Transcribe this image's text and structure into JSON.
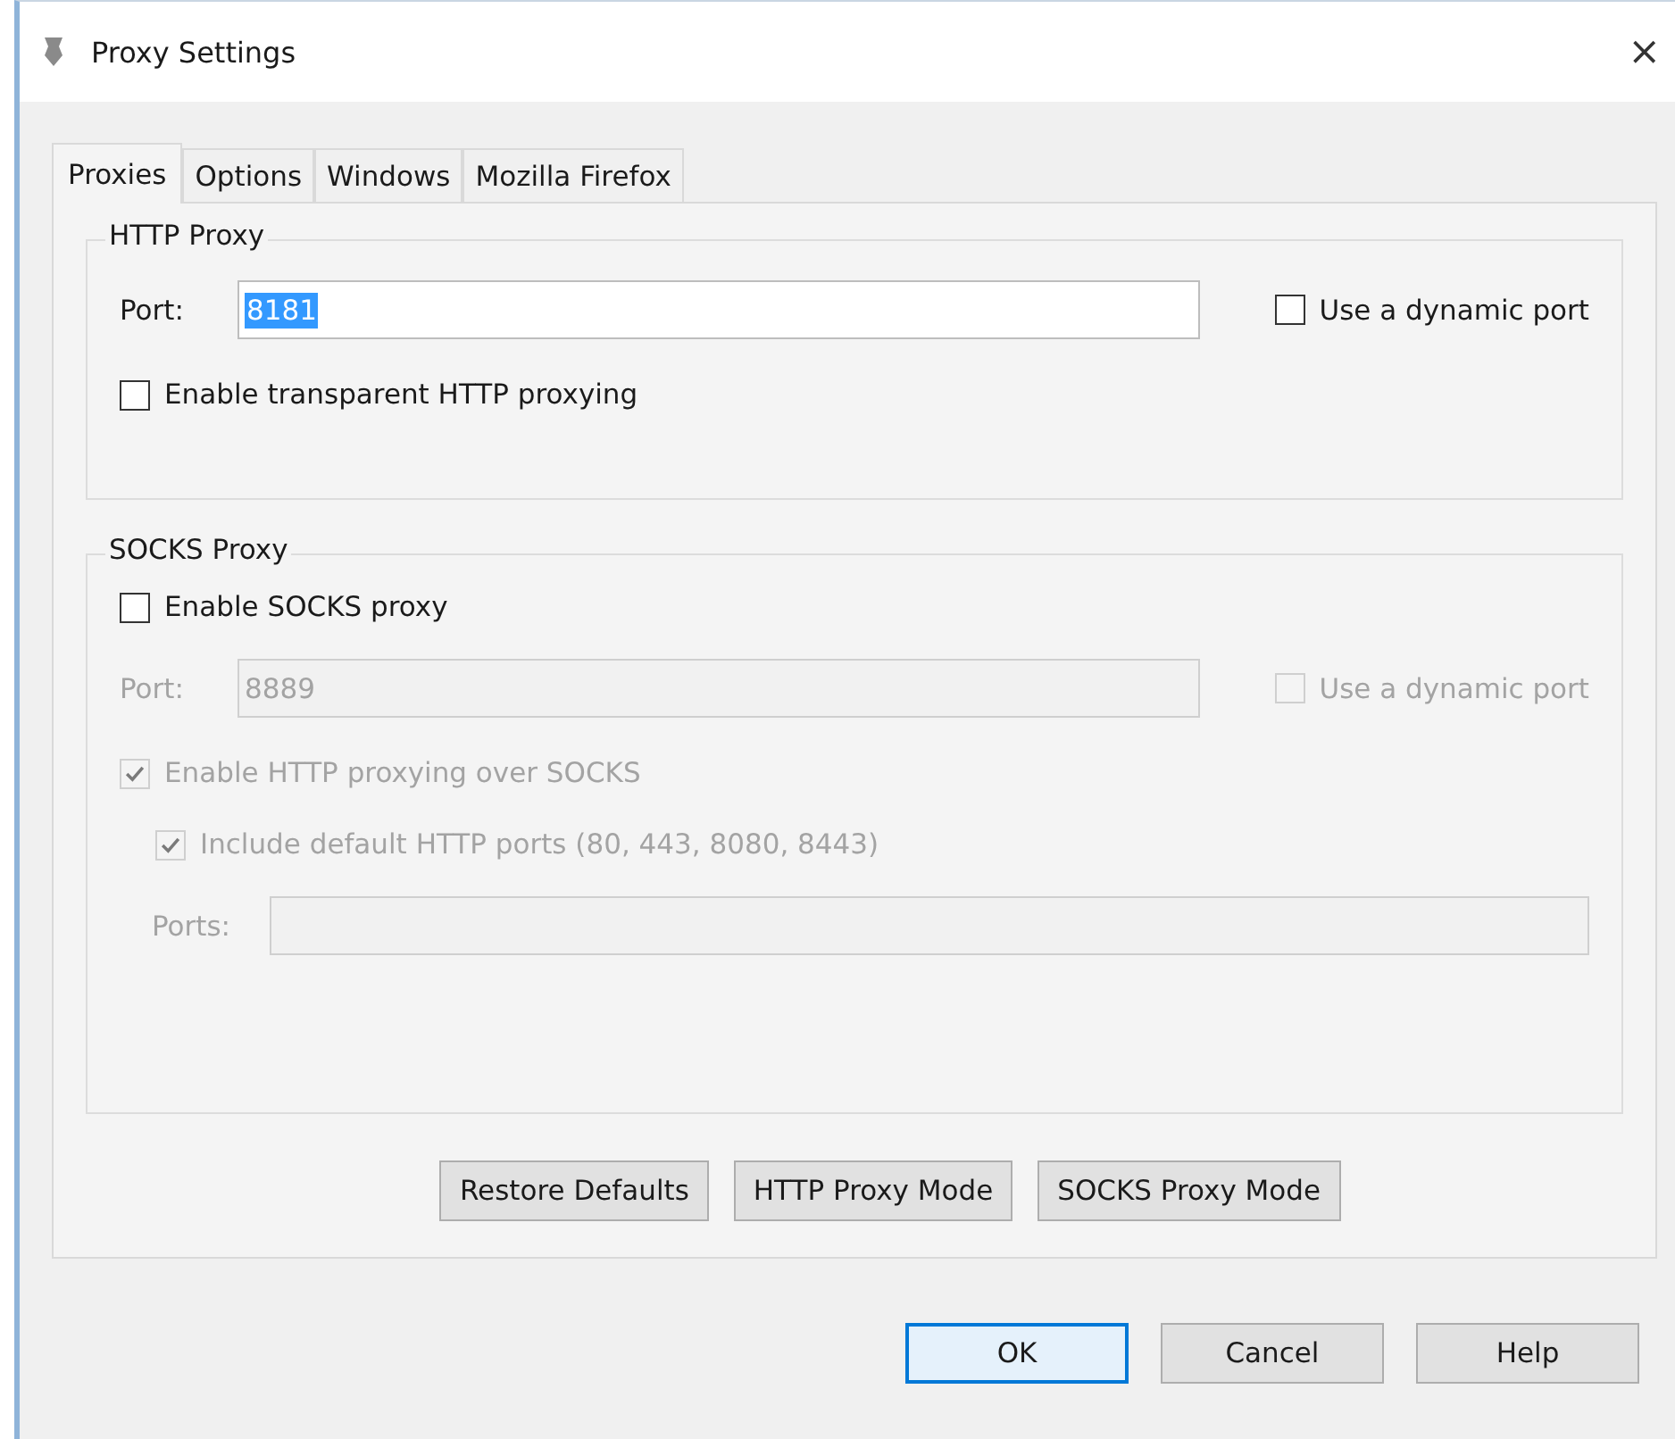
{
  "window": {
    "title": "Proxy Settings",
    "close": "×"
  },
  "tabs": [
    {
      "label": "Proxies",
      "selected": true
    },
    {
      "label": "Options",
      "selected": false
    },
    {
      "label": "Windows",
      "selected": false
    },
    {
      "label": "Mozilla Firefox",
      "selected": false
    }
  ],
  "http_proxy": {
    "title": "HTTP Proxy",
    "port_label": "Port:",
    "port_value": "8181",
    "port_value_selected": true,
    "port_disabled": false,
    "dynamic_port": {
      "label": "Use a dynamic port",
      "checked": false,
      "disabled": false
    },
    "transparent": {
      "label": "Enable transparent HTTP proxying",
      "checked": false,
      "disabled": false
    }
  },
  "socks_proxy": {
    "title": "SOCKS Proxy",
    "enable": {
      "label": "Enable SOCKS proxy",
      "checked": false,
      "disabled": false
    },
    "port_label": "Port:",
    "port_value": "8889",
    "port_disabled": true,
    "dynamic_port": {
      "label": "Use a dynamic port",
      "checked": false,
      "disabled": true
    },
    "http_over_socks": {
      "label": "Enable HTTP proxying over SOCKS",
      "checked": true,
      "disabled": true
    },
    "include_default_ports": {
      "label": "Include default HTTP ports (80, 443, 8080, 8443)",
      "checked": true,
      "disabled": true
    },
    "ports_label": "Ports:",
    "ports_disabled": true
  },
  "panel_buttons": [
    {
      "label": "Restore Defaults"
    },
    {
      "label": "HTTP Proxy Mode"
    },
    {
      "label": "SOCKS Proxy Mode"
    }
  ],
  "dialog_buttons": [
    {
      "label": "OK",
      "default": true
    },
    {
      "label": "Cancel",
      "default": false
    },
    {
      "label": "Help",
      "default": false
    }
  ]
}
